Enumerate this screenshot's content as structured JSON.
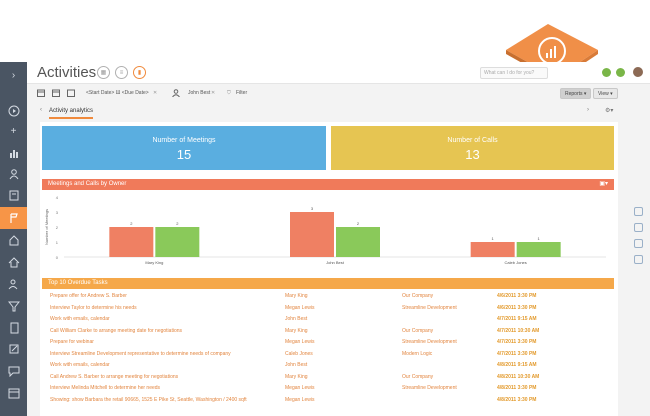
{
  "app": {
    "title": "Activities"
  },
  "search": {
    "placeholder": "What can I do for you?"
  },
  "filters": {
    "date_range": "<Start Date> Ш <Due Date>",
    "owner": "John Best",
    "filter_label": "Filter"
  },
  "toolbar": {
    "reports_label": "Reports",
    "view_label": "View"
  },
  "tabs": {
    "active": "Activity analytics"
  },
  "tiles": [
    {
      "label": "Number of Meetings",
      "value": "15",
      "color": "#5aaee0"
    },
    {
      "label": "Number of Calls",
      "value": "13",
      "color": "#e6c552"
    }
  ],
  "chart_panel": {
    "title": "Meetings and Calls by Owner",
    "color": "#f07a5a"
  },
  "chart_data": {
    "type": "bar",
    "title": "Meetings and Calls by Owner",
    "ylabel": "Number of Meetings",
    "categories": [
      "Mary King",
      "John Best",
      "Caleb Jones"
    ],
    "series": [
      {
        "values": [
          2,
          3,
          1
        ],
        "color": "#ef8063"
      },
      {
        "values": [
          2,
          2,
          1
        ],
        "color": "#8ac95a"
      }
    ],
    "yticks": [
      "0",
      "1",
      "2",
      "3",
      "4"
    ],
    "ylim": [
      0,
      4
    ]
  },
  "tasks_panel": {
    "title": "Top 10 Overdue Tasks",
    "color": "#f5a84a"
  },
  "tasks": [
    {
      "subject": "Prepare offer for Andrew S. Barber",
      "owner": "Mary King",
      "account": "Our Company",
      "date": "4/6/2011 3:30 PM"
    },
    {
      "subject": "Interview Taylor to determine his needs",
      "owner": "Megan Lewis",
      "account": "Streamline Development",
      "date": "4/6/2011 3:30 PM"
    },
    {
      "subject": "Work with emails, calendar",
      "owner": "John Best",
      "account": "",
      "date": "4/7/2011 9:15 AM"
    },
    {
      "subject": "Call William Clarke to arrange meeting date for negotiations",
      "owner": "Mary King",
      "account": "Our Company",
      "date": "4/7/2011 10:30 AM"
    },
    {
      "subject": "Prepare for webinar",
      "owner": "Megan Lewis",
      "account": "Streamline Development",
      "date": "4/7/2011 3:30 PM"
    },
    {
      "subject": "Interview Streamline Development representative to determine needs of company",
      "owner": "Caleb Jones",
      "account": "Modern Logic",
      "date": "4/7/2011 3:30 PM"
    },
    {
      "subject": "Work with emails, calendar",
      "owner": "John Best",
      "account": "",
      "date": "4/8/2011 9:15 AM"
    },
    {
      "subject": "Call Andrew S. Barber to arrange meeting for negotiations",
      "owner": "Mary King",
      "account": "Our Company",
      "date": "4/8/2011 10:30 AM"
    },
    {
      "subject": "Interview Melinda Mitchell to determine her needs",
      "owner": "Megan Lewis",
      "account": "Streamline Development",
      "date": "4/8/2011 3:30 PM"
    },
    {
      "subject": "Showing: show Barbara the retail 90665, 1525 E Pike St, Seattle, Washington / 2400 sqft",
      "owner": "Megan Lewis",
      "account": "",
      "date": "4/8/2011 3:30 PM"
    }
  ],
  "colors": {
    "accent": "#f08a3c",
    "sidebar": "#4a5563"
  }
}
